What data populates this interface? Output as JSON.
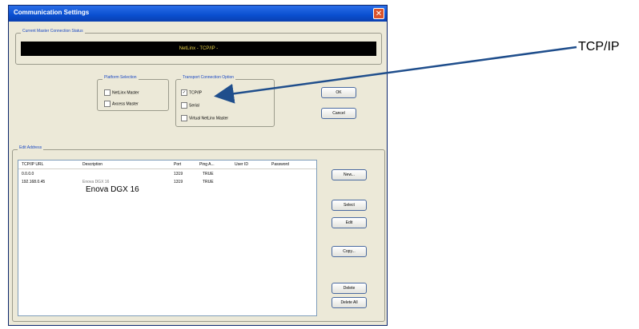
{
  "dialog": {
    "title": "Communication Settings",
    "close_icon": "close-icon",
    "status_group": {
      "label": "Current Master Connection Status",
      "status_text": "NetLinx - TCP/IP -"
    },
    "platform_group": {
      "label": "Platform Selection",
      "options": [
        "NetLinx Master",
        "Axcess Master"
      ]
    },
    "connection_group": {
      "label": "Transport Connection Option",
      "options": [
        {
          "label": "TCP/IP",
          "checked": true
        },
        {
          "label": "Serial",
          "checked": false
        },
        {
          "label": "Virtual NetLinx Master",
          "checked": false
        }
      ]
    },
    "ok_label": "OK",
    "cancel_label": "Cancel",
    "address_group": {
      "label": "Edit Address",
      "columns": [
        "TCP/IP URL",
        "Description",
        "Port",
        "Ping A...",
        "User ID",
        "Password"
      ],
      "rows": [
        {
          "url": "0.0.0.0",
          "description": "",
          "port": "1319",
          "ping": "TRUE",
          "user": "",
          "password": ""
        },
        {
          "url": "192.168.0.45",
          "description": "Enova DGX 16",
          "port": "1319",
          "ping": "TRUE",
          "user": "",
          "password": ""
        }
      ],
      "buttons": [
        "New...",
        "Select",
        "Edit",
        "Copy...",
        "Delete",
        "Delete All"
      ]
    }
  },
  "annotations": {
    "tcpip_label": "TCP/IP",
    "description_overlay": "Enova DGX 16",
    "arrow_color": "#1f4e8c"
  }
}
